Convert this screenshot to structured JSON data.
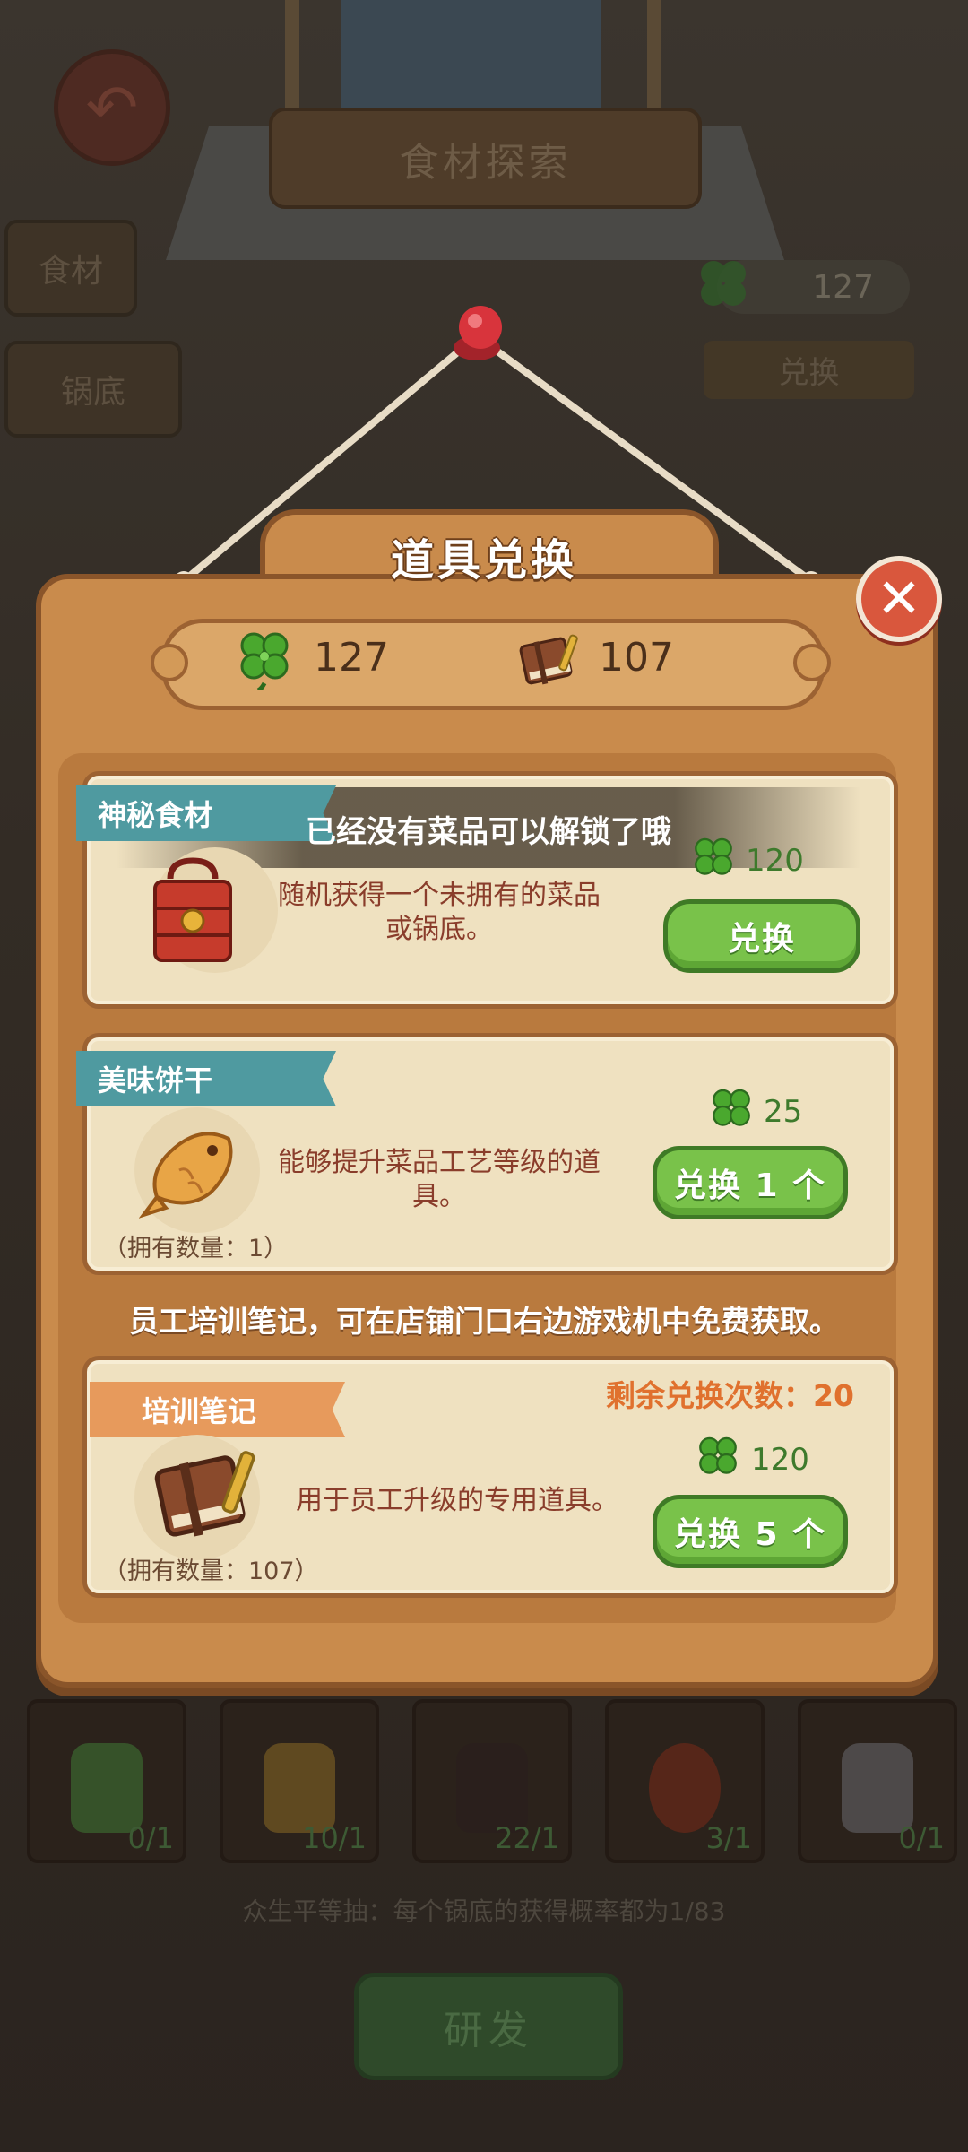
{
  "background": {
    "screen_title": "食材探索",
    "tabs": [
      "食材",
      "锅底"
    ],
    "clover_count": "127",
    "exchange_label": "兑换",
    "jars": [
      {
        "count": "0/1",
        "color": "#3f7a35"
      },
      {
        "count": "10/1",
        "color": "#8a6a25"
      },
      {
        "count": "22/1",
        "color": "#2a1e1e"
      },
      {
        "count": "3/1",
        "color": "#7a2a18"
      },
      {
        "count": "0/1",
        "color": "#6a6a70"
      }
    ],
    "hint": "众生平等抽：每个锅底的获得概率都为1/83",
    "research_label": "研发"
  },
  "dialog": {
    "title": "道具兑换",
    "currency": {
      "clover": "127",
      "notebook": "107"
    },
    "items": [
      {
        "ribbon": "神秘食材",
        "locked_message": "已经没有菜品可以解锁了哦",
        "description": "随机获得一个未拥有的菜品或锅底。",
        "price": "120",
        "button": "兑换"
      },
      {
        "ribbon": "美味饼干",
        "description": "能够提升菜品工艺等级的道具。",
        "owned": "（拥有数量：1）",
        "price": "25",
        "button": "兑换 1 个"
      },
      {
        "ribbon": "培训笔记",
        "remaining": "剩余兑换次数：20",
        "description": "用于员工升级的专用道具。",
        "owned": "（拥有数量：107）",
        "price": "120",
        "button": "兑换 5 个"
      }
    ],
    "info_line": "员工培训笔记，可在店铺门口右边游戏机中免费获取。"
  },
  "colors": {
    "panel": "#c98b4c",
    "card": "#efe1c0",
    "button_green": "#79c24a",
    "ribbon_teal": "#4f9aa0",
    "ribbon_orange": "#e79a5c",
    "close_red": "#d9573d"
  }
}
